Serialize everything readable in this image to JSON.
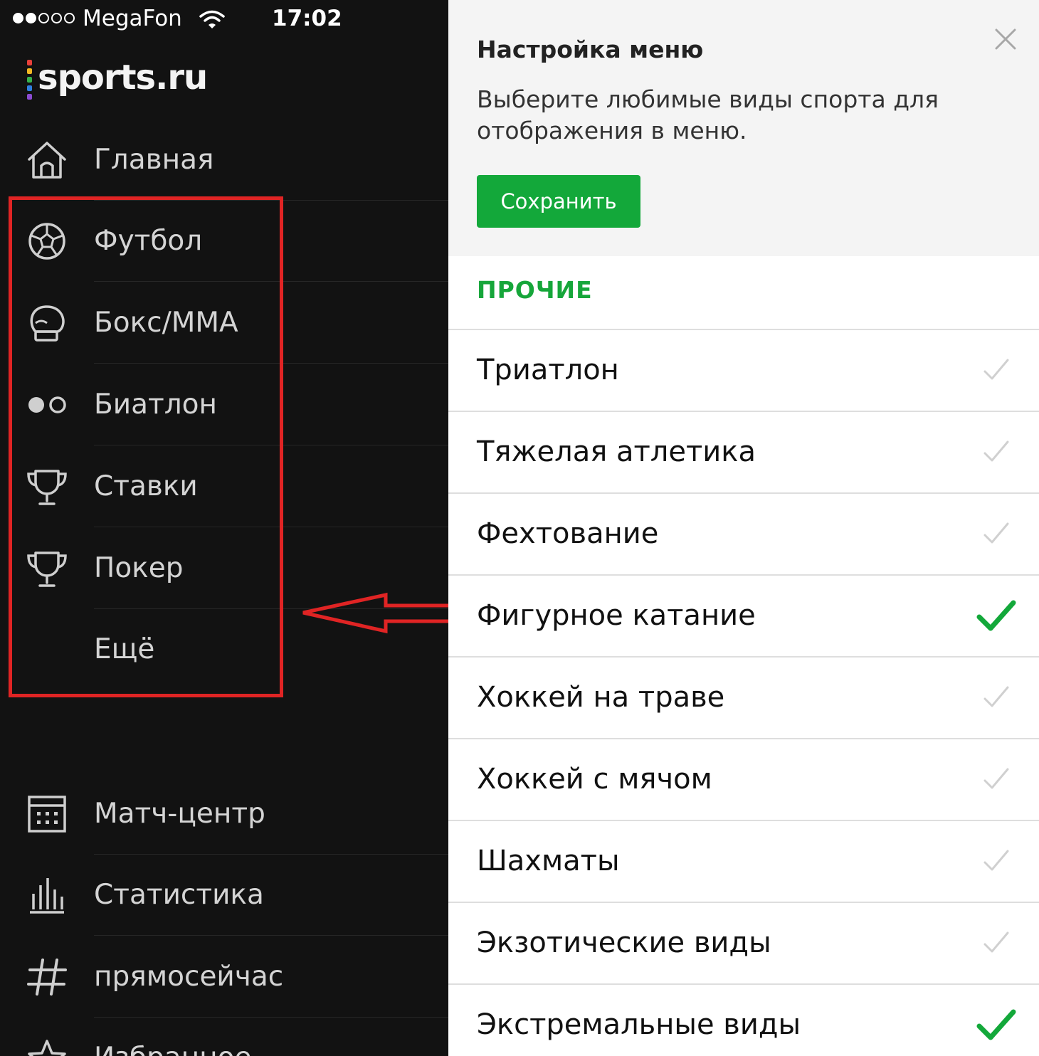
{
  "status_bar": {
    "carrier": "MegaFon",
    "time": "17:02",
    "signal_bars": 2,
    "signal_total": 5
  },
  "logo": {
    "text": "sports.ru"
  },
  "drawer": {
    "items": [
      {
        "label": "Главная",
        "icon": "home-icon"
      },
      {
        "label": "Футбол",
        "icon": "soccer-ball-icon"
      },
      {
        "label": "Бокс/MMA",
        "icon": "boxing-glove-icon"
      },
      {
        "label": "Биатлон",
        "icon": "biathlon-dots-icon"
      },
      {
        "label": "Ставки",
        "icon": "trophy-icon"
      },
      {
        "label": "Покер",
        "icon": "trophy-icon"
      },
      {
        "label": "Ещё",
        "icon": ""
      },
      {
        "label": "Матч-центр",
        "icon": "calendar-icon"
      },
      {
        "label": "Статистика",
        "icon": "bar-chart-icon"
      },
      {
        "label": "прямосейчас",
        "icon": "hashtag-icon"
      },
      {
        "label": "Избранное",
        "icon": "star-icon"
      }
    ]
  },
  "settings": {
    "title": "Настройка меню",
    "description": "Выберите любимые виды спорта для отображения в меню.",
    "save_label": "Сохранить",
    "section_title": "ПРОЧИЕ",
    "sports": [
      {
        "label": "Триатлон",
        "checked": false
      },
      {
        "label": "Тяжелая атлетика",
        "checked": false
      },
      {
        "label": "Фехтование",
        "checked": false
      },
      {
        "label": "Фигурное катание",
        "checked": true
      },
      {
        "label": "Хоккей на траве",
        "checked": false
      },
      {
        "label": "Хоккей с мячом",
        "checked": false
      },
      {
        "label": "Шахматы",
        "checked": false
      },
      {
        "label": "Экзотические виды",
        "checked": false
      },
      {
        "label": "Экстремальные виды",
        "checked": true
      }
    ]
  },
  "colors": {
    "drawer_bg": "#121212",
    "accent_green": "#13a83a",
    "annotation_red": "#e02424",
    "check_unchecked": "#d0d0d0"
  }
}
